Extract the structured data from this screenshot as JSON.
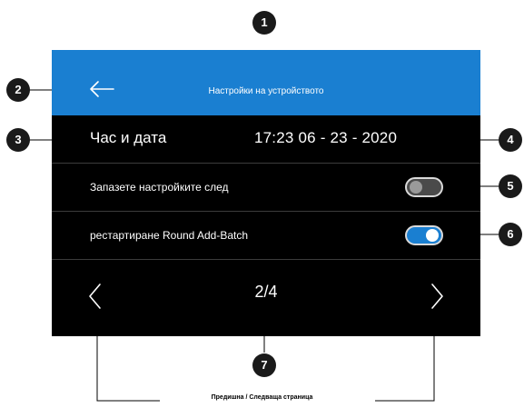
{
  "header": {
    "title": "Настройки на устройството",
    "back_icon": "arrow-left-icon"
  },
  "datetime": {
    "label": "Час и дата",
    "value": "17:23 06 - 23 - 2020"
  },
  "settings": [
    {
      "label": "Запазете настройките след",
      "toggle": "off"
    },
    {
      "label": "рестартиране Round Add-Batch",
      "toggle": "on"
    }
  ],
  "pager": {
    "indicator": "2/4",
    "prev_icon": "chevron-left-icon",
    "next_icon": "chevron-right-icon"
  },
  "callouts": [
    "1",
    "2",
    "3",
    "4",
    "5",
    "6",
    "7"
  ],
  "caption": "Предишна / Следваща страница",
  "colors": {
    "accent": "#1a7fd1",
    "screen_bg": "#000000",
    "badge": "#1a1a1a"
  }
}
